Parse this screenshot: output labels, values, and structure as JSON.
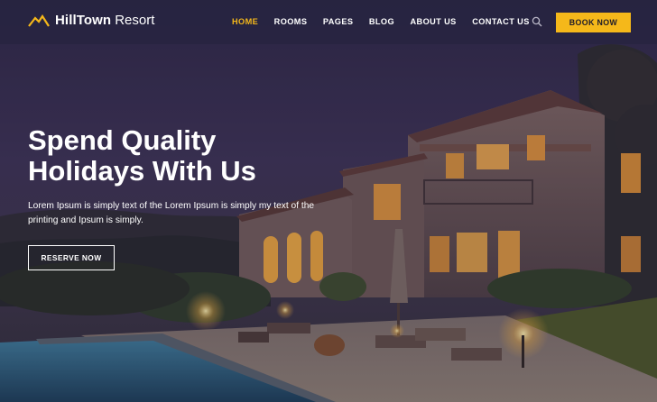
{
  "brand": {
    "name_bold": "HillTown",
    "name_light": "Resort",
    "logo_icon": "mountain-icon",
    "accent_color": "#f5b81a"
  },
  "nav": {
    "items": [
      {
        "label": "HOME",
        "active": true
      },
      {
        "label": "ROOMS",
        "active": false
      },
      {
        "label": "PAGES",
        "active": false
      },
      {
        "label": "BLOG",
        "active": false
      },
      {
        "label": "ABOUT US",
        "active": false
      },
      {
        "label": "CONTACT US",
        "active": false
      }
    ],
    "search_icon": "search-icon",
    "cta_label": "BOOK NOW"
  },
  "hero": {
    "title_line1": "Spend Quality",
    "title_line2": "Holidays With Us",
    "text": "Lorem Ipsum is simply text of the Lorem Ipsum is simply my text of the printing and Ipsum is simply.",
    "button_label": "RESERVE NOW"
  }
}
